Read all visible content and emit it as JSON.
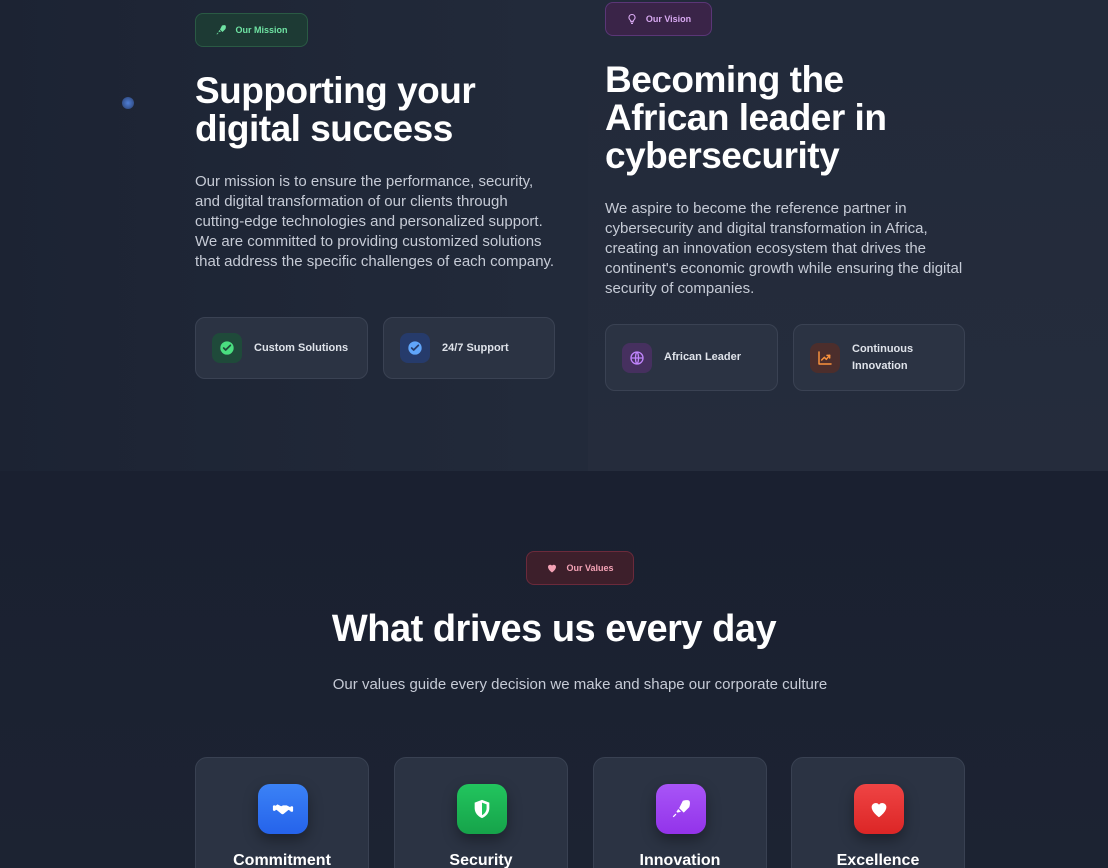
{
  "mission": {
    "badge": "Our Mission",
    "title": "Supporting your digital success",
    "text": "Our mission is to ensure the performance, security, and digital transformation of our clients through cutting-edge technologies and personalized support. We are committed to providing customized solutions that address the specific challenges of each company.",
    "features": [
      {
        "label": "Custom Solutions",
        "icon": "check-circle-icon"
      },
      {
        "label": "24/7 Support",
        "icon": "badge-check-icon"
      }
    ]
  },
  "vision": {
    "badge": "Our Vision",
    "title": "Becoming the African leader in cybersecurity",
    "text": "We aspire to become the reference partner in cybersecurity and digital transformation in Africa, creating an innovation ecosystem that drives the continent's economic growth while ensuring the digital security of companies.",
    "features": [
      {
        "label": "African Leader",
        "icon": "globe-icon"
      },
      {
        "label": "Continuous Innovation",
        "icon": "chart-line-icon"
      }
    ]
  },
  "values": {
    "badge": "Our Values",
    "title": "What drives us every day",
    "subtitle": "Our values guide every decision we make and shape our corporate culture",
    "cards": [
      {
        "title": "Commitment",
        "icon": "handshake-icon",
        "color": "#3b82f6"
      },
      {
        "title": "Security",
        "icon": "shield-icon",
        "color": "#22c55e"
      },
      {
        "title": "Innovation",
        "icon": "rocket-icon",
        "color": "#a855f7"
      },
      {
        "title": "Excellence",
        "icon": "heart-icon",
        "color": "#ef4444"
      }
    ]
  },
  "colors": {
    "mission_accent": "#6fe3a3",
    "vision_accent": "#d7a8f0",
    "values_accent": "#f3a2b5"
  }
}
